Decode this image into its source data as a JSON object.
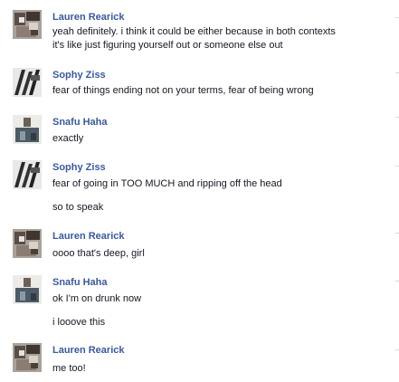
{
  "messages": [
    {
      "sender": "Lauren Rearick",
      "lines": [
        "yeah definitely. i think it could be either because in both contexts",
        "it's like just figuring yourself out or someone else out"
      ],
      "avatar": "lauren-avatar"
    },
    {
      "sender": "Sophy Ziss",
      "lines": [
        "fear of things ending not on your terms, fear of being wrong"
      ],
      "avatar": "sophy-avatar"
    },
    {
      "sender": "Snafu Haha",
      "lines": [
        "exactly"
      ],
      "avatar": "snafu-avatar"
    },
    {
      "sender": "Sophy Ziss",
      "lines": [
        "fear of going in TOO MUCH and ripping off the head",
        "so to speak"
      ],
      "avatar": "sophy-avatar"
    },
    {
      "sender": "Lauren Rearick",
      "lines": [
        "oooo that's deep, girl"
      ],
      "avatar": "lauren-avatar"
    },
    {
      "sender": "Snafu Haha",
      "lines": [
        "ok I'm on drunk now",
        "i looove this"
      ],
      "avatar": "snafu-avatar"
    },
    {
      "sender": "Lauren Rearick",
      "lines": [
        "me too!"
      ],
      "avatar": "lauren-avatar"
    }
  ]
}
